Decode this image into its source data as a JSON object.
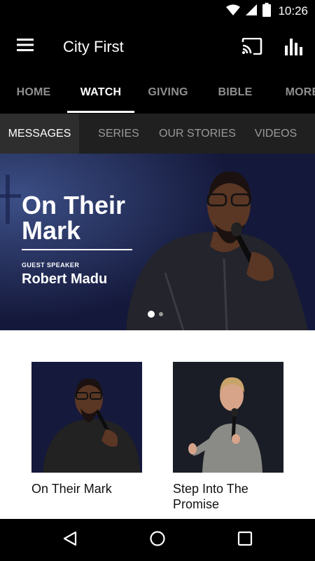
{
  "status_bar": {
    "time": "10:26"
  },
  "app_bar": {
    "title": "City First"
  },
  "main_tabs": [
    {
      "label": "HOME",
      "active": false
    },
    {
      "label": "WATCH",
      "active": true
    },
    {
      "label": "GIVING",
      "active": false
    },
    {
      "label": "BIBLE",
      "active": false
    },
    {
      "label": "MORE",
      "active": false
    }
  ],
  "sub_tabs": [
    {
      "label": "MESSAGES",
      "active": true
    },
    {
      "label": "SERIES",
      "active": false
    },
    {
      "label": "OUR STORIES",
      "active": false
    },
    {
      "label": "VIDEOS",
      "active": false
    }
  ],
  "hero": {
    "title": "On Their Mark",
    "label": "GUEST SPEAKER",
    "speaker": "Robert Madu",
    "slide_count": 2,
    "active_slide": 1
  },
  "cards": [
    {
      "title": "On Their Mark"
    },
    {
      "title": "Step Into The Promise"
    }
  ],
  "colors": {
    "bar_background": "#000000",
    "subtab_background": "#202020",
    "hero_background": "#14183a",
    "tab_inactive": "#8f8f8f"
  }
}
